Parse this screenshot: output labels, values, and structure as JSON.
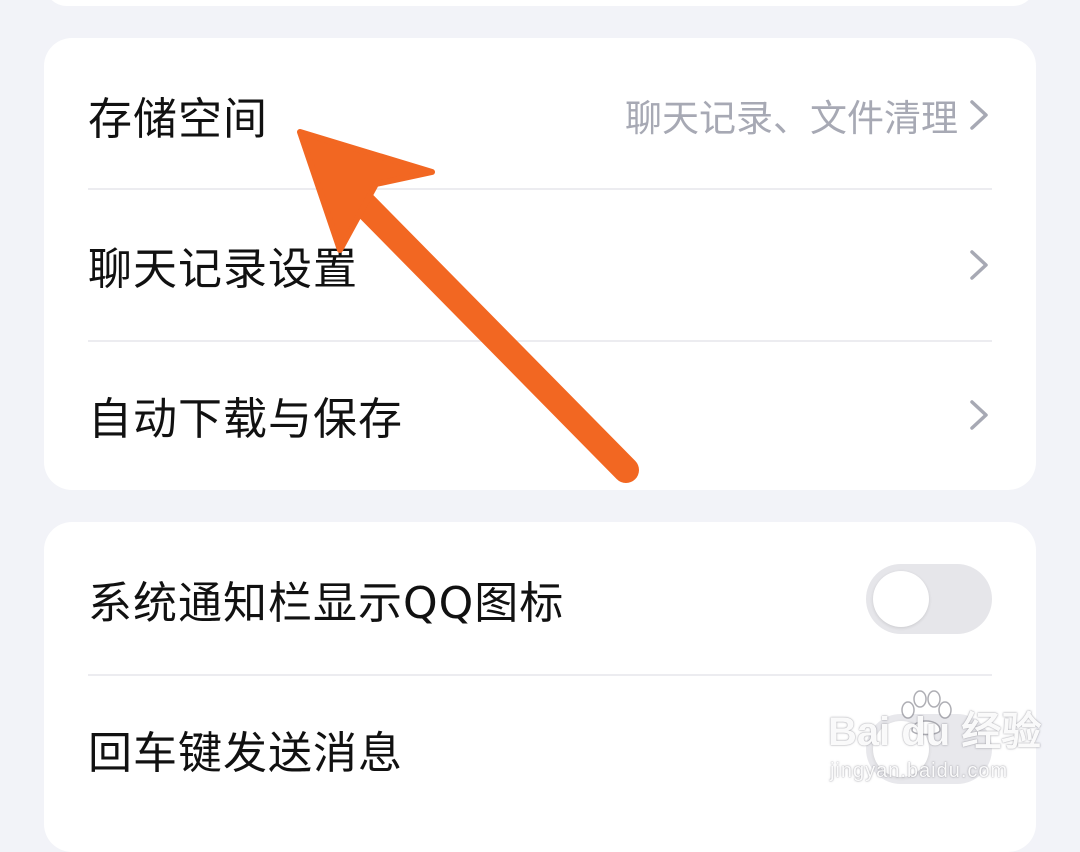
{
  "settings": {
    "storage": {
      "label": "存储空间",
      "hint": "聊天记录、文件清理"
    },
    "chat_history": {
      "label": "聊天记录设置"
    },
    "auto_download": {
      "label": "自动下载与保存"
    },
    "notification_icon": {
      "label": "系统通知栏显示QQ图标",
      "enabled": false
    },
    "enter_to_send": {
      "label": "回车键发送消息",
      "enabled": false
    }
  },
  "watermark": {
    "logo": "Bai du 经验",
    "url": "jingyan.baidu.com"
  },
  "colors": {
    "background": "#f2f3f8",
    "card": "#ffffff",
    "arrow": "#f26722",
    "toggle_off": "#e6e6ea",
    "hint_text": "#a7a9b4"
  },
  "icons": {
    "chevron": "chevron-right-icon",
    "annotation": "annotation-arrow-icon",
    "watermark_paw": "paw-icon"
  }
}
